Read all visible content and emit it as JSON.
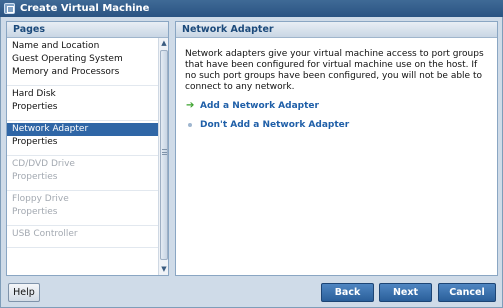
{
  "window": {
    "title": "Create Virtual Machine"
  },
  "pages_panel": {
    "header": "Pages",
    "groups": [
      {
        "items": [
          {
            "label": "Name and Location",
            "state": "normal"
          },
          {
            "label": "Guest Operating System",
            "state": "normal"
          },
          {
            "label": "Memory and Processors",
            "state": "normal"
          }
        ]
      },
      {
        "items": [
          {
            "label": "Hard Disk",
            "state": "normal"
          },
          {
            "label": "Properties",
            "state": "normal"
          }
        ]
      },
      {
        "items": [
          {
            "label": "Network Adapter",
            "state": "selected"
          },
          {
            "label": "Properties",
            "state": "normal"
          }
        ]
      },
      {
        "items": [
          {
            "label": "CD/DVD Drive",
            "state": "disabled"
          },
          {
            "label": "Properties",
            "state": "disabled"
          }
        ]
      },
      {
        "items": [
          {
            "label": "Floppy Drive",
            "state": "disabled"
          },
          {
            "label": "Properties",
            "state": "disabled"
          }
        ]
      },
      {
        "items": [
          {
            "label": "USB Controller",
            "state": "disabled"
          }
        ]
      }
    ]
  },
  "content_panel": {
    "header": "Network Adapter",
    "description": "Network adapters give your virtual machine access to port groups that have been configured for virtual machine use on the host. If no such port groups have been configured, you will not be able to connect to any network.",
    "options": [
      {
        "label": "Add a Network Adapter",
        "icon": "green-arrow-icon"
      },
      {
        "label": "Don't Add a Network Adapter",
        "icon": "bullet-dot-icon"
      }
    ]
  },
  "buttons": {
    "help": "Help",
    "back": "Back",
    "next": "Next",
    "cancel": "Cancel"
  },
  "colors": {
    "titlebar": "#2f5d8c",
    "selected": "#2f66a6",
    "link": "#1f5fa8",
    "button": "#3a6fae"
  }
}
